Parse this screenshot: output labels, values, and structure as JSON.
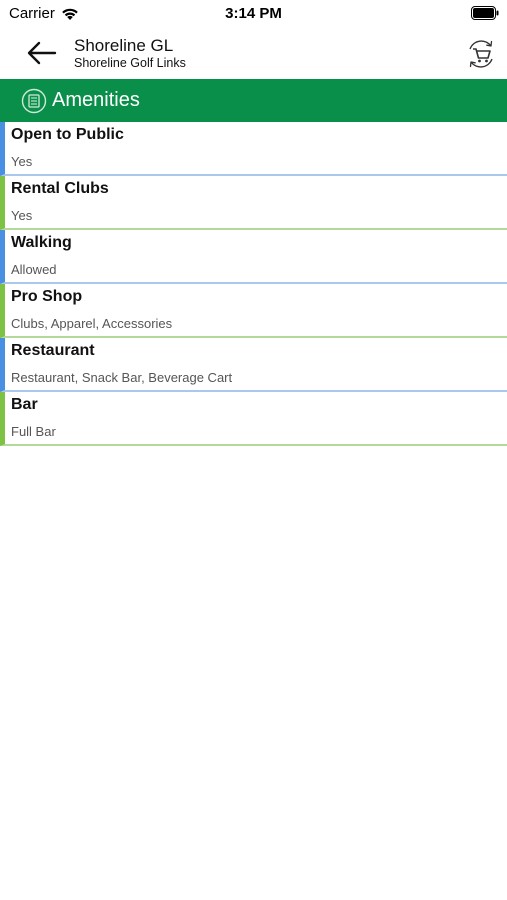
{
  "status_bar": {
    "carrier": "Carrier",
    "time": "3:14 PM",
    "icons": [
      "wifi-icon",
      "battery-icon"
    ]
  },
  "header": {
    "title": "Shoreline GL",
    "subtitle": "Shoreline Golf Links",
    "back_icon": "back-arrow-icon",
    "action_icon": "cart-sync-icon"
  },
  "section": {
    "title": "Amenities",
    "icon": "list-doc-icon",
    "color": "#0a8f4b"
  },
  "amenities": [
    {
      "name": "Open to Public",
      "value": "Yes"
    },
    {
      "name": "Rental Clubs",
      "value": "Yes"
    },
    {
      "name": "Walking",
      "value": "Allowed"
    },
    {
      "name": "Pro Shop",
      "value": "Clubs, Apparel, Accessories"
    },
    {
      "name": "Restaurant",
      "value": "Restaurant, Snack Bar, Beverage Cart"
    },
    {
      "name": "Bar",
      "value": "Full Bar"
    }
  ],
  "colors": {
    "accent_blue": "#4a90e2",
    "accent_green": "#7dc242"
  }
}
